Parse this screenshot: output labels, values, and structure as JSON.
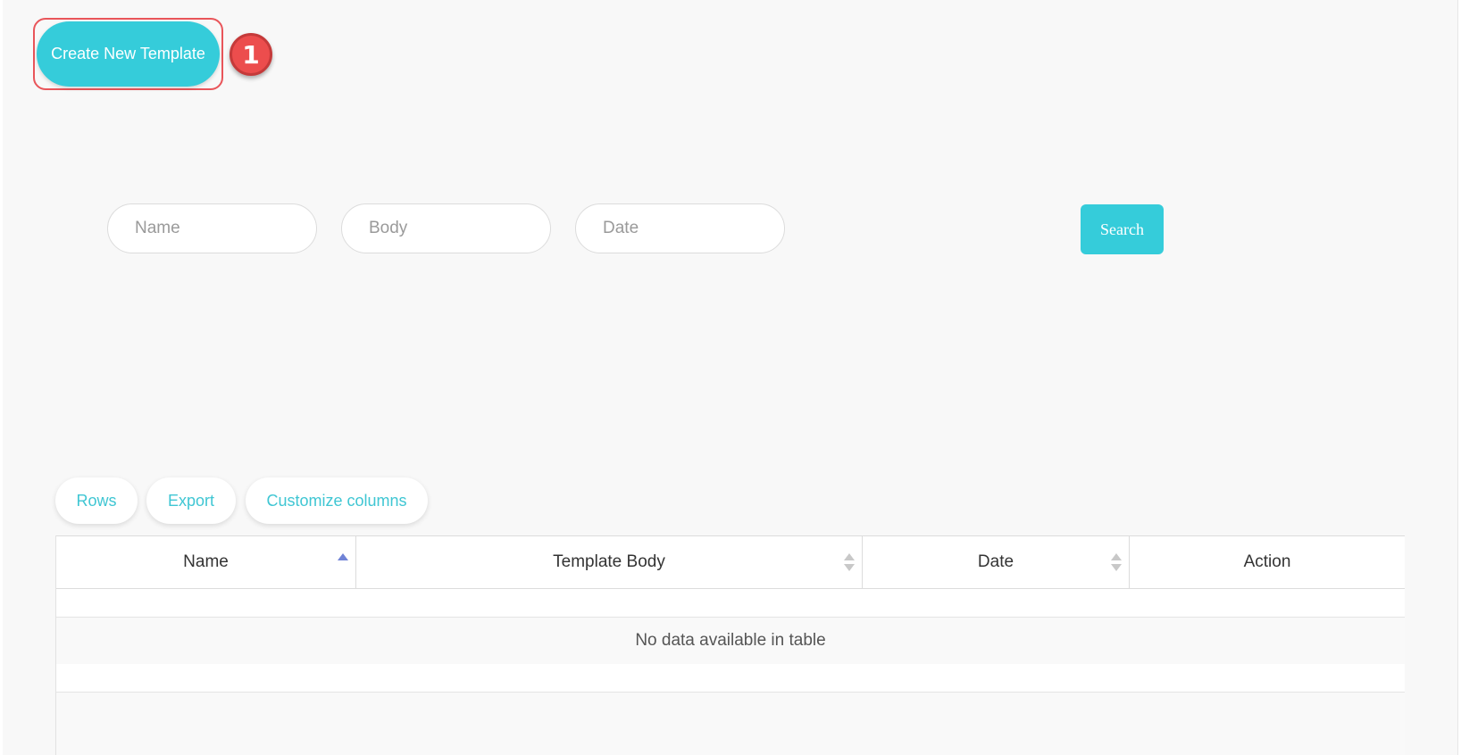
{
  "header": {
    "create_button_label": "Create New Template",
    "step_badge": "1",
    "highlight_color": "#e9555a",
    "badge_color": "#ec4d4d"
  },
  "filters": {
    "name_placeholder": "Name",
    "body_placeholder": "Body",
    "date_placeholder": "Date",
    "search_label": "Search"
  },
  "toolbar": {
    "rows_label": "Rows",
    "export_label": "Export",
    "customize_label": "Customize columns"
  },
  "table": {
    "columns": [
      {
        "label": "Name",
        "sort": "asc",
        "sort_icon": "sort-asc-icon"
      },
      {
        "label": "Template Body",
        "sort": "none",
        "sort_icon": "sort-both-icon"
      },
      {
        "label": "Date",
        "sort": "none",
        "sort_icon": "sort-both-icon"
      },
      {
        "label": "Action",
        "sort": "none",
        "sort_icon": ""
      }
    ],
    "empty_message": "No data available in table"
  },
  "colors": {
    "accent": "#35ccda",
    "accent_text": "#3fc6d3",
    "sort_active": "#7083d6",
    "sort_inactive": "#c8c8c8"
  }
}
